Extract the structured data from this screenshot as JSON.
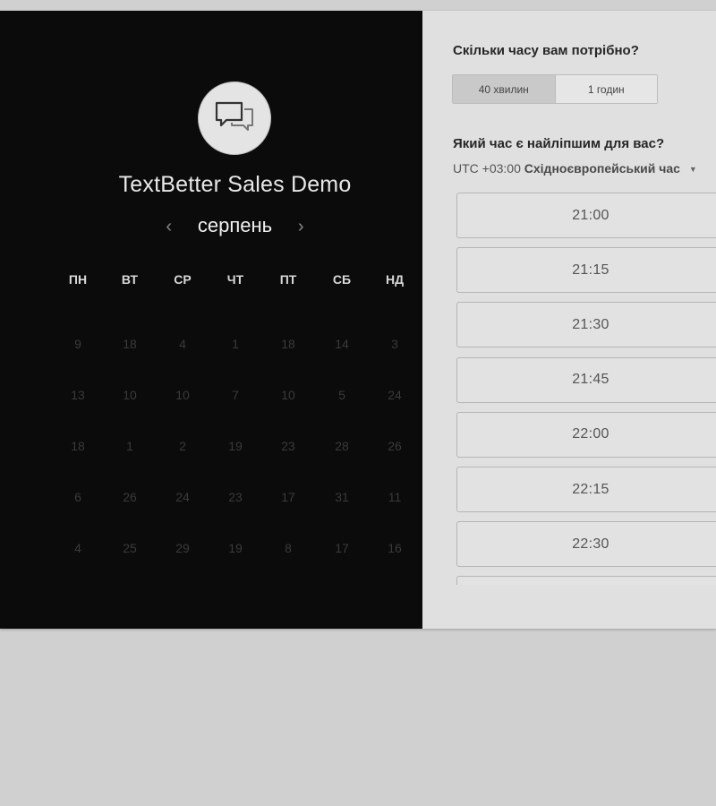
{
  "event": {
    "title": "TextBetter Sales Demo",
    "avatar_icon": "chat-bubbles-icon"
  },
  "calendar": {
    "month": "серпень",
    "prev_icon": "‹",
    "next_icon": "›",
    "weekdays": [
      "ПН",
      "ВТ",
      "СР",
      "ЧТ",
      "ПТ",
      "СБ",
      "НД"
    ],
    "weeks": [
      [
        "9",
        "18",
        "4",
        "1",
        "18",
        "14",
        "3"
      ],
      [
        "13",
        "10",
        "10",
        "7",
        "10",
        "5",
        "24"
      ],
      [
        "18",
        "1",
        "2",
        "19",
        "23",
        "28",
        "26"
      ],
      [
        "6",
        "26",
        "24",
        "23",
        "17",
        "31",
        "11"
      ],
      [
        "4",
        "25",
        "29",
        "19",
        "8",
        "17",
        "16"
      ]
    ]
  },
  "duration": {
    "question": "Скільки часу вам потрібно?",
    "options": [
      "40 хвилин",
      "1 годин"
    ],
    "selected_index": 0
  },
  "time": {
    "question": "Який час є найліпшим для вас?",
    "timezone_offset": "UTC +03:00",
    "timezone_name": "Східноєвропейський час",
    "slots": [
      "21:00",
      "21:15",
      "21:30",
      "21:45",
      "22:00",
      "22:15",
      "22:30"
    ]
  },
  "colors": {
    "left_bg": "#0b0b0b",
    "right_bg": "#e0e0e0",
    "page_bg": "#d0d0d0"
  }
}
